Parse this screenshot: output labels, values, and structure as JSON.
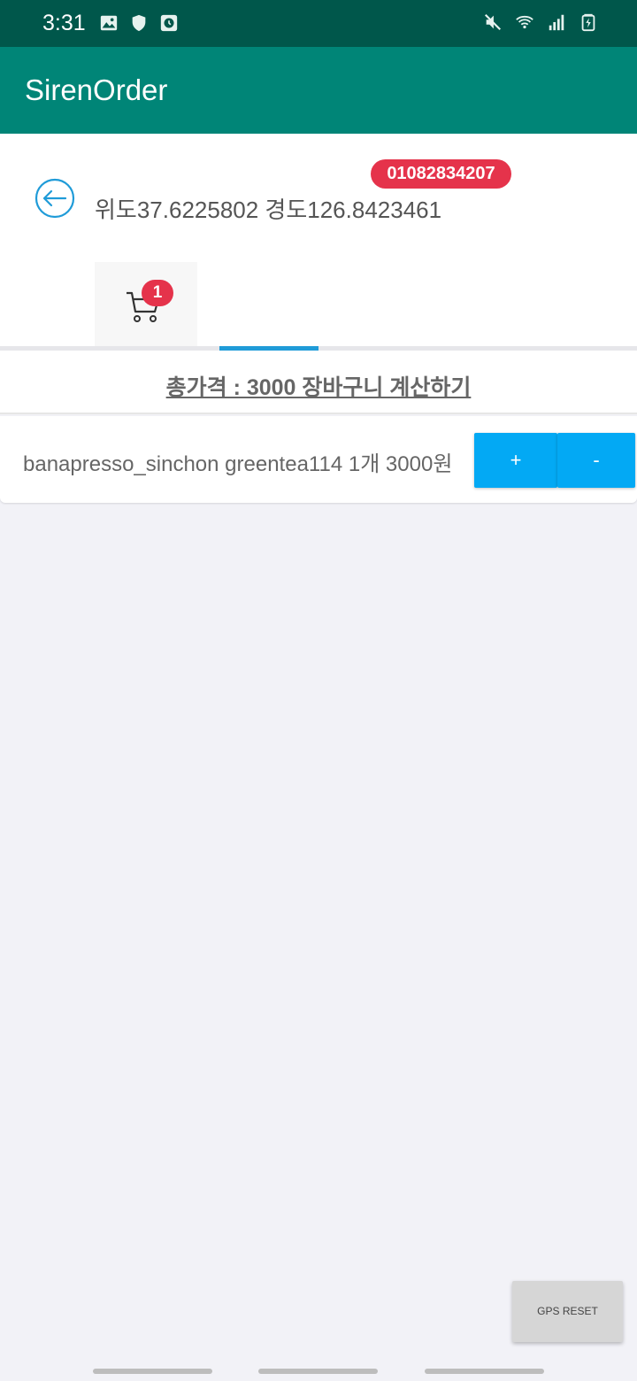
{
  "status_bar": {
    "time": "3:31",
    "left_icons": [
      "image-icon",
      "shield-icon",
      "clock-icon"
    ],
    "right_icons": [
      "mute-icon",
      "wifi-icon",
      "signal-icon",
      "battery-icon"
    ]
  },
  "app_bar": {
    "title": "SirenOrder",
    "color": "#008577"
  },
  "location": {
    "text": "위도37.6225802 경도126.8423461"
  },
  "tabs": {
    "cart_badge": "1",
    "phone": "01082834207"
  },
  "cart": {
    "total_text": "총가격 : 3000 장바구니 계산하기",
    "items": [
      {
        "text": "banapresso_sinchon greentea114 1개 3000원",
        "plus": "+",
        "minus": "-"
      }
    ]
  },
  "gps_button": "GPS RESET",
  "colors": {
    "accent": "#03a9f4",
    "badge": "#e5334b",
    "status_bar": "#00574b"
  }
}
